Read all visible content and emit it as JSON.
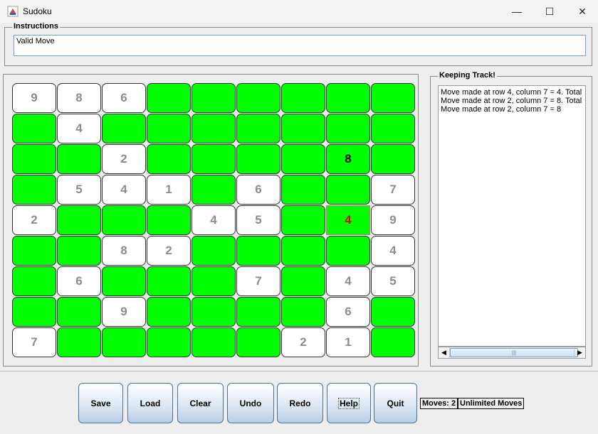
{
  "window": {
    "title": "Sudoku",
    "minimize": "—",
    "maximize": "☐",
    "close": "✕"
  },
  "instructions": {
    "legend": "Instructions",
    "text": "Valid Move"
  },
  "board": {
    "rows": [
      [
        "9",
        "8",
        "6",
        "",
        "",
        "",
        "",
        "",
        ""
      ],
      [
        "",
        "4",
        "",
        "",
        "",
        "",
        "",
        "",
        ""
      ],
      [
        "",
        "",
        "2",
        "",
        "",
        "",
        "",
        "8",
        ""
      ],
      [
        "",
        "5",
        "4",
        "1",
        "",
        "6",
        "",
        "",
        "7"
      ],
      [
        "2",
        "",
        "",
        "",
        "4",
        "5",
        "",
        "4",
        "9"
      ],
      [
        "",
        "",
        "8",
        "2",
        "",
        "",
        "",
        "",
        "4"
      ],
      [
        "",
        "6",
        "",
        "",
        "",
        "7",
        "",
        "4",
        "5"
      ],
      [
        "",
        "",
        "9",
        "",
        "",
        "",
        "",
        "6",
        ""
      ],
      [
        "7",
        "",
        "",
        "",
        "",
        "",
        "2",
        "1",
        ""
      ]
    ],
    "user_entered": [
      [
        2,
        7
      ],
      [
        4,
        7
      ]
    ],
    "selected": [
      4,
      7
    ],
    "colors": {
      "empty": "#00ff00",
      "given": "#ffffff",
      "given_text": "#8c8c8c",
      "user_text": "#000000",
      "selected_text": "#e00000"
    }
  },
  "tracking": {
    "legend": "Keeping Track!",
    "lines": [
      "Move made at row 4, column 7 = 4. Total",
      "Move made at row 2, column 7 = 8. Total",
      "Move made at row 2, column 7 = 8"
    ],
    "scroll_thumb_grip": "|||"
  },
  "toolbar": {
    "buttons": [
      "Save",
      "Load",
      "Clear",
      "Undo",
      "Redo",
      "Help",
      "Quit"
    ],
    "moves_label": "Moves: 2",
    "mode_label": "Unlimited Moves"
  }
}
